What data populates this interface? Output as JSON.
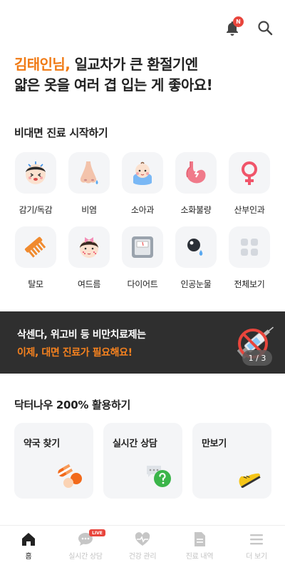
{
  "header": {
    "notification_badge": "N",
    "icons": [
      "bell-icon",
      "search-icon"
    ]
  },
  "greeting": {
    "name": "김태인님,",
    "line1_rest": " 일교차가 큰 환절기엔",
    "line2": "얇은 옷을 여러 겹 입는 게 좋아요!",
    "name_color": "#f07a14"
  },
  "telemedicine": {
    "title": "비대면 진료 시작하기",
    "categories": [
      {
        "label": "감기/독감",
        "icon": "sick-face-icon"
      },
      {
        "label": "비염",
        "icon": "runny-nose-icon"
      },
      {
        "label": "소아과",
        "icon": "baby-icon"
      },
      {
        "label": "소화불량",
        "icon": "stomach-icon"
      },
      {
        "label": "산부인과",
        "icon": "female-icon"
      },
      {
        "label": "탈모",
        "icon": "comb-icon"
      },
      {
        "label": "여드름",
        "icon": "acne-face-icon"
      },
      {
        "label": "다이어트",
        "icon": "scale-icon"
      },
      {
        "label": "인공눈물",
        "icon": "eye-drop-icon"
      },
      {
        "label": "전체보기",
        "icon": "grid-icon"
      }
    ]
  },
  "banner": {
    "line1": "삭센다, 위고비 등 비만치료제는",
    "line2": "이제, 대면 진료가 필요해요!",
    "page_indicator": "1 / 3",
    "accent_color": "#f6821f"
  },
  "features": {
    "title": "닥터나우 200% 활용하기",
    "cards": [
      {
        "label": "약국 찾기",
        "icon": "pills-icon"
      },
      {
        "label": "실시간 상담",
        "icon": "chat-question-icon"
      },
      {
        "label": "만보기",
        "icon": "sneaker-icon"
      }
    ]
  },
  "tabbar": {
    "live_badge": "LIVE",
    "tabs": [
      {
        "label": "홈",
        "active": true
      },
      {
        "label": "실시간 상담",
        "active": false
      },
      {
        "label": "건강 관리",
        "active": false
      },
      {
        "label": "진료 내역",
        "active": false
      },
      {
        "label": "더 보기",
        "active": false
      }
    ]
  }
}
